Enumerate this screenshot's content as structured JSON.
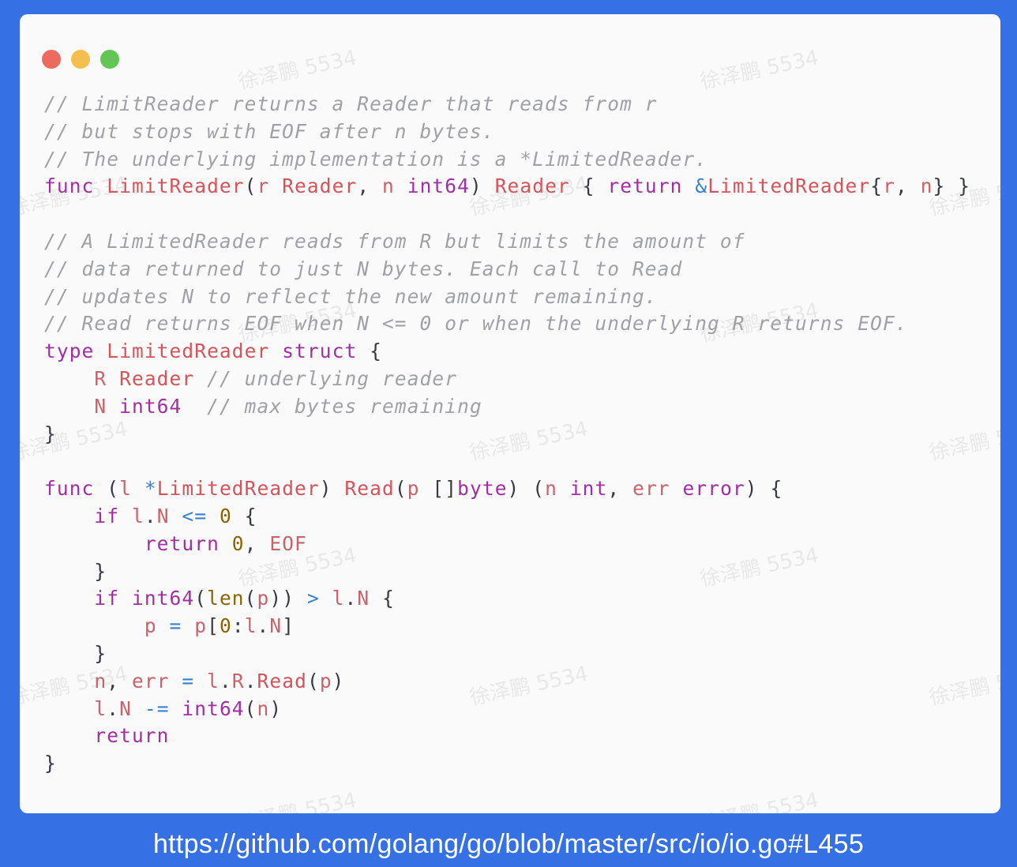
{
  "window": {
    "controls": [
      "close",
      "minimize",
      "zoom"
    ],
    "colors": {
      "close": "#ed6a5e",
      "minimize": "#f5bf4f",
      "zoom": "#62c554",
      "background": "#3570e5"
    }
  },
  "code_lines": [
    [
      {
        "t": "// LimitReader returns a Reader that reads from r",
        "c": "c"
      }
    ],
    [
      {
        "t": "// but stops with EOF after n bytes.",
        "c": "c"
      }
    ],
    [
      {
        "t": "// The underlying implementation is a *LimitedReader.",
        "c": "c"
      }
    ],
    [
      {
        "t": "func",
        "c": "k"
      },
      {
        "t": " ",
        "c": "p"
      },
      {
        "t": "LimitReader",
        "c": "f"
      },
      {
        "t": "(",
        "c": "p"
      },
      {
        "t": "r",
        "c": "v"
      },
      {
        "t": " ",
        "c": "p"
      },
      {
        "t": "Reader",
        "c": "f"
      },
      {
        "t": ", ",
        "c": "p"
      },
      {
        "t": "n",
        "c": "v"
      },
      {
        "t": " ",
        "c": "p"
      },
      {
        "t": "int64",
        "c": "k"
      },
      {
        "t": ") ",
        "c": "p"
      },
      {
        "t": "Reader",
        "c": "f"
      },
      {
        "t": " { ",
        "c": "p"
      },
      {
        "t": "return",
        "c": "k"
      },
      {
        "t": " ",
        "c": "p"
      },
      {
        "t": "&",
        "c": "o"
      },
      {
        "t": "LimitedReader",
        "c": "f"
      },
      {
        "t": "{",
        "c": "p"
      },
      {
        "t": "r",
        "c": "v"
      },
      {
        "t": ", ",
        "c": "p"
      },
      {
        "t": "n",
        "c": "v"
      },
      {
        "t": "} }",
        "c": "p"
      }
    ],
    [],
    [
      {
        "t": "// A LimitedReader reads from R but limits the amount of",
        "c": "c"
      }
    ],
    [
      {
        "t": "// data returned to just N bytes. Each call to Read",
        "c": "c"
      }
    ],
    [
      {
        "t": "// updates N to reflect the new amount remaining.",
        "c": "c"
      }
    ],
    [
      {
        "t": "// Read returns EOF when N <= 0 or when the underlying R returns EOF.",
        "c": "c"
      }
    ],
    [
      {
        "t": "type",
        "c": "k"
      },
      {
        "t": " ",
        "c": "p"
      },
      {
        "t": "LimitedReader",
        "c": "f"
      },
      {
        "t": " ",
        "c": "p"
      },
      {
        "t": "struct",
        "c": "k"
      },
      {
        "t": " {",
        "c": "p"
      }
    ],
    [
      {
        "t": "    ",
        "c": "p"
      },
      {
        "t": "R",
        "c": "v"
      },
      {
        "t": " ",
        "c": "p"
      },
      {
        "t": "Reader",
        "c": "f"
      },
      {
        "t": " ",
        "c": "p"
      },
      {
        "t": "// underlying reader",
        "c": "c"
      }
    ],
    [
      {
        "t": "    ",
        "c": "p"
      },
      {
        "t": "N",
        "c": "v"
      },
      {
        "t": " ",
        "c": "p"
      },
      {
        "t": "int64",
        "c": "k"
      },
      {
        "t": "  ",
        "c": "p"
      },
      {
        "t": "// max bytes remaining",
        "c": "c"
      }
    ],
    [
      {
        "t": "}",
        "c": "p"
      }
    ],
    [],
    [
      {
        "t": "func",
        "c": "k"
      },
      {
        "t": " (",
        "c": "p"
      },
      {
        "t": "l",
        "c": "v"
      },
      {
        "t": " ",
        "c": "p"
      },
      {
        "t": "*",
        "c": "o"
      },
      {
        "t": "LimitedReader",
        "c": "f"
      },
      {
        "t": ") ",
        "c": "p"
      },
      {
        "t": "Read",
        "c": "f"
      },
      {
        "t": "(",
        "c": "p"
      },
      {
        "t": "p",
        "c": "v"
      },
      {
        "t": " []",
        "c": "p"
      },
      {
        "t": "byte",
        "c": "k"
      },
      {
        "t": ") (",
        "c": "p"
      },
      {
        "t": "n",
        "c": "v"
      },
      {
        "t": " ",
        "c": "p"
      },
      {
        "t": "int",
        "c": "k"
      },
      {
        "t": ", ",
        "c": "p"
      },
      {
        "t": "err",
        "c": "v"
      },
      {
        "t": " ",
        "c": "p"
      },
      {
        "t": "error",
        "c": "k"
      },
      {
        "t": ") {",
        "c": "p"
      }
    ],
    [
      {
        "t": "    ",
        "c": "p"
      },
      {
        "t": "if",
        "c": "k"
      },
      {
        "t": " ",
        "c": "p"
      },
      {
        "t": "l",
        "c": "v"
      },
      {
        "t": ".",
        "c": "p"
      },
      {
        "t": "N",
        "c": "v"
      },
      {
        "t": " ",
        "c": "p"
      },
      {
        "t": "<=",
        "c": "o"
      },
      {
        "t": " ",
        "c": "p"
      },
      {
        "t": "0",
        "c": "n"
      },
      {
        "t": " {",
        "c": "p"
      }
    ],
    [
      {
        "t": "        ",
        "c": "p"
      },
      {
        "t": "return",
        "c": "k"
      },
      {
        "t": " ",
        "c": "p"
      },
      {
        "t": "0",
        "c": "n"
      },
      {
        "t": ", ",
        "c": "p"
      },
      {
        "t": "EOF",
        "c": "v"
      }
    ],
    [
      {
        "t": "    }",
        "c": "p"
      }
    ],
    [
      {
        "t": "    ",
        "c": "p"
      },
      {
        "t": "if",
        "c": "k"
      },
      {
        "t": " ",
        "c": "p"
      },
      {
        "t": "int64",
        "c": "k"
      },
      {
        "t": "(",
        "c": "p"
      },
      {
        "t": "len",
        "c": "n"
      },
      {
        "t": "(",
        "c": "p"
      },
      {
        "t": "p",
        "c": "v"
      },
      {
        "t": ")) ",
        "c": "p"
      },
      {
        "t": ">",
        "c": "o"
      },
      {
        "t": " ",
        "c": "p"
      },
      {
        "t": "l",
        "c": "v"
      },
      {
        "t": ".",
        "c": "p"
      },
      {
        "t": "N",
        "c": "v"
      },
      {
        "t": " {",
        "c": "p"
      }
    ],
    [
      {
        "t": "        ",
        "c": "p"
      },
      {
        "t": "p",
        "c": "v"
      },
      {
        "t": " ",
        "c": "p"
      },
      {
        "t": "=",
        "c": "o"
      },
      {
        "t": " ",
        "c": "p"
      },
      {
        "t": "p",
        "c": "v"
      },
      {
        "t": "[",
        "c": "p"
      },
      {
        "t": "0",
        "c": "n"
      },
      {
        "t": ":",
        "c": "p"
      },
      {
        "t": "l",
        "c": "v"
      },
      {
        "t": ".",
        "c": "p"
      },
      {
        "t": "N",
        "c": "v"
      },
      {
        "t": "]",
        "c": "p"
      }
    ],
    [
      {
        "t": "    }",
        "c": "p"
      }
    ],
    [
      {
        "t": "    ",
        "c": "p"
      },
      {
        "t": "n",
        "c": "v"
      },
      {
        "t": ", ",
        "c": "p"
      },
      {
        "t": "err",
        "c": "v"
      },
      {
        "t": " ",
        "c": "p"
      },
      {
        "t": "=",
        "c": "o"
      },
      {
        "t": " ",
        "c": "p"
      },
      {
        "t": "l",
        "c": "v"
      },
      {
        "t": ".",
        "c": "p"
      },
      {
        "t": "R",
        "c": "v"
      },
      {
        "t": ".",
        "c": "p"
      },
      {
        "t": "Read",
        "c": "f"
      },
      {
        "t": "(",
        "c": "p"
      },
      {
        "t": "p",
        "c": "v"
      },
      {
        "t": ")",
        "c": "p"
      }
    ],
    [
      {
        "t": "    ",
        "c": "p"
      },
      {
        "t": "l",
        "c": "v"
      },
      {
        "t": ".",
        "c": "p"
      },
      {
        "t": "N",
        "c": "v"
      },
      {
        "t": " ",
        "c": "p"
      },
      {
        "t": "-=",
        "c": "o"
      },
      {
        "t": " ",
        "c": "p"
      },
      {
        "t": "int64",
        "c": "k"
      },
      {
        "t": "(",
        "c": "p"
      },
      {
        "t": "n",
        "c": "v"
      },
      {
        "t": ")",
        "c": "p"
      }
    ],
    [
      {
        "t": "    ",
        "c": "p"
      },
      {
        "t": "return",
        "c": "k"
      }
    ],
    [
      {
        "t": "}",
        "c": "p"
      }
    ]
  ],
  "watermark": "徐泽鹏 5534",
  "source_url": "https://github.com/golang/go/blob/master/src/io/io.go#L455"
}
